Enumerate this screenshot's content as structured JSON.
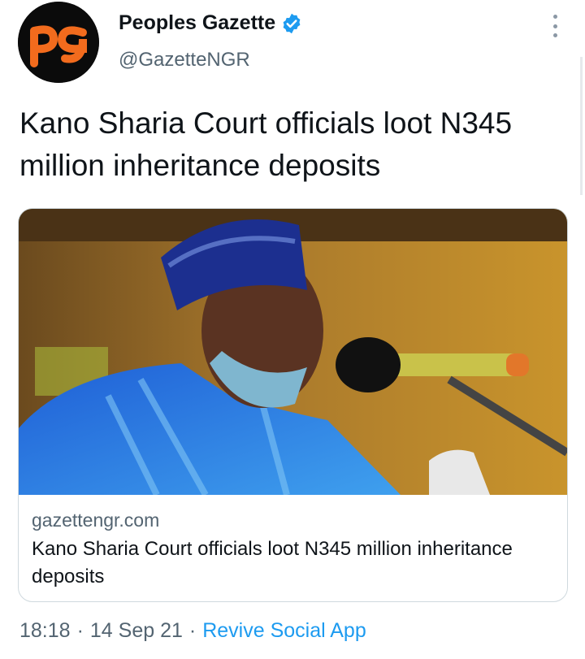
{
  "account": {
    "display_name": "Peoples Gazette",
    "handle": "@GazetteNGR",
    "logo_text": "PG",
    "verified": true
  },
  "tweet": {
    "text": "Kano Sharia Court officials loot N345 million inheritance deposits"
  },
  "link_card": {
    "domain": "gazettengr.com",
    "title": "Kano Sharia Court officials loot N345 million inheritance deposits",
    "image": "photo of a man in blue cap and face mask speaking at a microphone"
  },
  "meta": {
    "time": "18:18",
    "date": "14 Sep 21",
    "separator": "·",
    "source": "Revive Social App"
  },
  "colors": {
    "link": "#1d9bf0",
    "secondary_text": "#536471",
    "logo_orange": "#f26b1d",
    "verified": "#1d9bf0"
  },
  "icons": [
    "verified-badge-icon",
    "more-options-icon"
  ]
}
